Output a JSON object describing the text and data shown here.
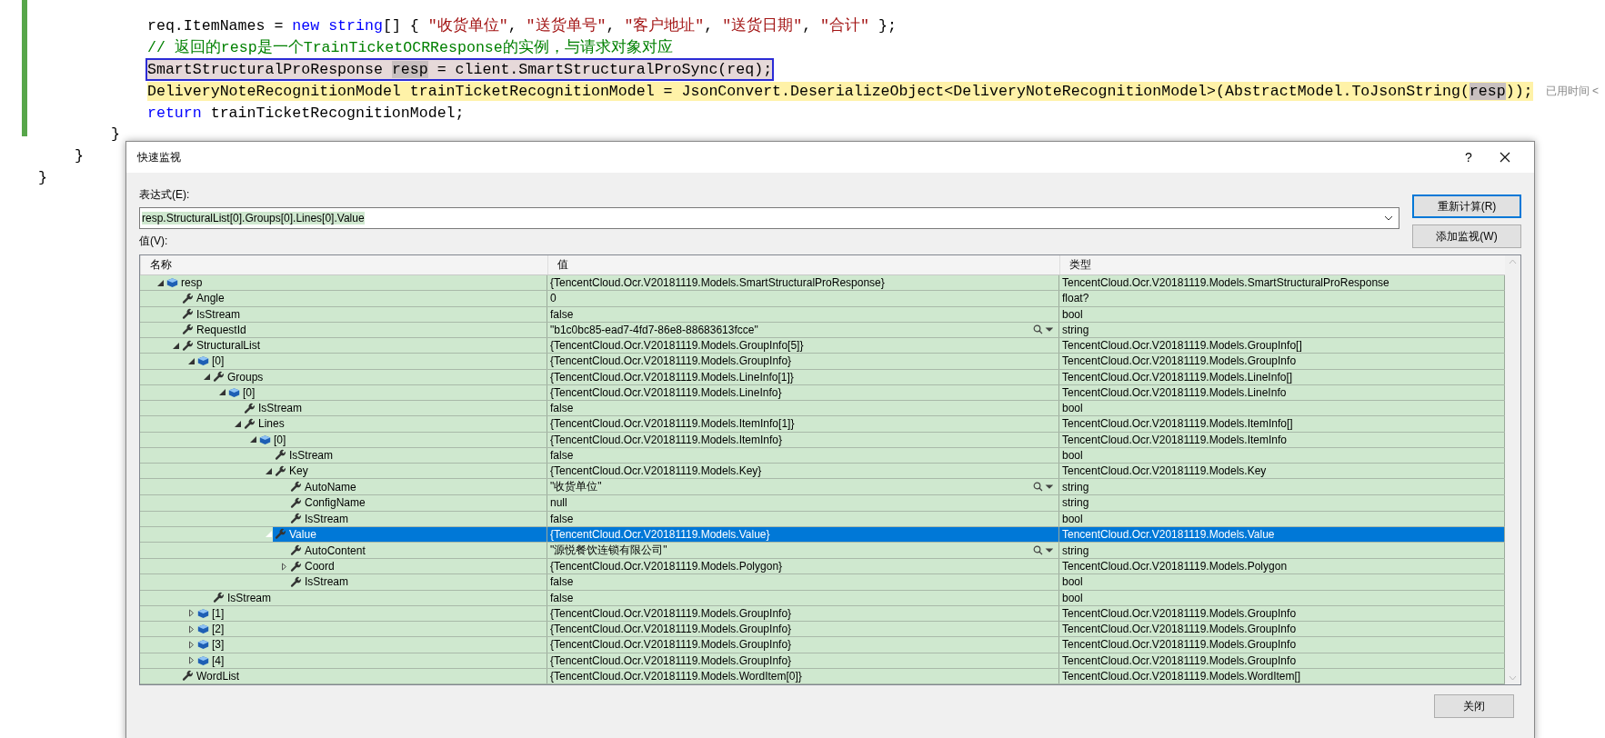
{
  "editor": {
    "lines": [
      {
        "selected": false,
        "current": false,
        "segments": [
          {
            "kind": "plain",
            "text": "req.ItemNames = "
          },
          {
            "kind": "keyword",
            "text": "new string"
          },
          {
            "kind": "plain",
            "text": "[] { "
          },
          {
            "kind": "string",
            "text": "\"收货单位\""
          },
          {
            "kind": "plain",
            "text": ", "
          },
          {
            "kind": "string",
            "text": "\"送货单号\""
          },
          {
            "kind": "plain",
            "text": ", "
          },
          {
            "kind": "string",
            "text": "\"客户地址\""
          },
          {
            "kind": "plain",
            "text": ", "
          },
          {
            "kind": "string",
            "text": "\"送货日期\""
          },
          {
            "kind": "plain",
            "text": ", "
          },
          {
            "kind": "string",
            "text": "\"合计\""
          },
          {
            "kind": "plain",
            "text": " };"
          }
        ]
      },
      {
        "selected": false,
        "current": false,
        "segments": [
          {
            "kind": "comment",
            "text": "// 返回的resp是一个TrainTicketOCRResponse的实例，与请求对象对应"
          }
        ]
      },
      {
        "selected": true,
        "current": false,
        "segments": [
          {
            "kind": "plain",
            "text": "SmartStructuralProResponse "
          },
          {
            "kind": "reference",
            "text": "resp"
          },
          {
            "kind": "plain",
            "text": " = client.SmartStructuralProSync(req);"
          }
        ]
      },
      {
        "selected": false,
        "current": true,
        "segments": [
          {
            "kind": "plain",
            "text": "DeliveryNoteRecognitionModel trainTicketRecognitionModel = JsonConvert.DeserializeObject<DeliveryNoteRecognitionModel>(AbstractModel.ToJsonString("
          },
          {
            "kind": "reference",
            "text": "resp"
          },
          {
            "kind": "plain",
            "text": "));"
          }
        ],
        "hint": "已用时间 <"
      },
      {
        "selected": false,
        "current": false,
        "segments": [
          {
            "kind": "keyword",
            "text": "return"
          },
          {
            "kind": "plain",
            "text": " trainTicketRecognitionModel;"
          }
        ]
      }
    ],
    "braces": [
      "}",
      "}",
      "}"
    ]
  },
  "quick_watch": {
    "title": "快速监视",
    "help": "?",
    "expression_label": "表达式(E):",
    "expression": "resp.StructuralList[0].Groups[0].Lines[0].Value",
    "value_label": "值(V):",
    "buttons": [
      {
        "label": "重新计算(R)",
        "kind": "default"
      },
      {
        "label": "添加监视(W)",
        "kind": "normal"
      }
    ],
    "columns": [
      "名称",
      "值",
      "类型"
    ],
    "items": [
      {
        "name": "resp",
        "kind": "object",
        "expanded": true,
        "value": "{TencentCloud.Ocr.V20181119.Models.SmartStructuralProResponse}",
        "type": "TencentCloud.Ocr.V20181119.Models.SmartStructuralProResponse",
        "viewer": false,
        "selected": false,
        "children": [
          {
            "name": "Angle",
            "kind": "property",
            "value": "0",
            "type": "float?",
            "viewer": false,
            "selected": false
          },
          {
            "name": "IsStream",
            "kind": "property",
            "value": "false",
            "type": "bool",
            "viewer": false,
            "selected": false
          },
          {
            "name": "RequestId",
            "kind": "property",
            "value": "\"b1c0bc85-ead7-4fd7-86e8-88683613fcce\"",
            "type": "string",
            "viewer": true,
            "selected": false
          },
          {
            "name": "StructuralList",
            "kind": "property",
            "expanded": true,
            "value": "{TencentCloud.Ocr.V20181119.Models.GroupInfo[5]}",
            "type": "TencentCloud.Ocr.V20181119.Models.GroupInfo[]",
            "viewer": false,
            "selected": false,
            "children": [
              {
                "name": "[0]",
                "kind": "object",
                "expanded": true,
                "value": "{TencentCloud.Ocr.V20181119.Models.GroupInfo}",
                "type": "TencentCloud.Ocr.V20181119.Models.GroupInfo",
                "viewer": false,
                "selected": false,
                "children": [
                  {
                    "name": "Groups",
                    "kind": "property",
                    "expanded": true,
                    "value": "{TencentCloud.Ocr.V20181119.Models.LineInfo[1]}",
                    "type": "TencentCloud.Ocr.V20181119.Models.LineInfo[]",
                    "viewer": false,
                    "selected": false,
                    "children": [
                      {
                        "name": "[0]",
                        "kind": "object",
                        "expanded": true,
                        "value": "{TencentCloud.Ocr.V20181119.Models.LineInfo}",
                        "type": "TencentCloud.Ocr.V20181119.Models.LineInfo",
                        "viewer": false,
                        "selected": false,
                        "children": [
                          {
                            "name": "IsStream",
                            "kind": "property",
                            "value": "false",
                            "type": "bool",
                            "viewer": false,
                            "selected": false
                          },
                          {
                            "name": "Lines",
                            "kind": "property",
                            "expanded": true,
                            "value": "{TencentCloud.Ocr.V20181119.Models.ItemInfo[1]}",
                            "type": "TencentCloud.Ocr.V20181119.Models.ItemInfo[]",
                            "viewer": false,
                            "selected": false,
                            "children": [
                              {
                                "name": "[0]",
                                "kind": "object",
                                "expanded": true,
                                "value": "{TencentCloud.Ocr.V20181119.Models.ItemInfo}",
                                "type": "TencentCloud.Ocr.V20181119.Models.ItemInfo",
                                "viewer": false,
                                "selected": false,
                                "children": [
                                  {
                                    "name": "IsStream",
                                    "kind": "property",
                                    "value": "false",
                                    "type": "bool",
                                    "viewer": false,
                                    "selected": false
                                  },
                                  {
                                    "name": "Key",
                                    "kind": "property",
                                    "expanded": true,
                                    "value": "{TencentCloud.Ocr.V20181119.Models.Key}",
                                    "type": "TencentCloud.Ocr.V20181119.Models.Key",
                                    "viewer": false,
                                    "selected": false,
                                    "children": [
                                      {
                                        "name": "AutoName",
                                        "kind": "property",
                                        "value": "\"收货单位\"",
                                        "type": "string",
                                        "viewer": true,
                                        "selected": false
                                      },
                                      {
                                        "name": "ConfigName",
                                        "kind": "property",
                                        "value": "null",
                                        "type": "string",
                                        "viewer": false,
                                        "selected": false
                                      },
                                      {
                                        "name": "IsStream",
                                        "kind": "property",
                                        "value": "false",
                                        "type": "bool",
                                        "viewer": false,
                                        "selected": false
                                      }
                                    ]
                                  },
                                  {
                                    "name": "Value",
                                    "kind": "property",
                                    "expanded": true,
                                    "value": "{TencentCloud.Ocr.V20181119.Models.Value}",
                                    "type": "TencentCloud.Ocr.V20181119.Models.Value",
                                    "viewer": false,
                                    "selected": true,
                                    "children": [
                                      {
                                        "name": "AutoContent",
                                        "kind": "property",
                                        "value": "\"源悦餐饮连锁有限公司\"",
                                        "type": "string",
                                        "viewer": true,
                                        "selected": false
                                      },
                                      {
                                        "name": "Coord",
                                        "kind": "property",
                                        "expanded": false,
                                        "value": "{TencentCloud.Ocr.V20181119.Models.Polygon}",
                                        "type": "TencentCloud.Ocr.V20181119.Models.Polygon",
                                        "viewer": false,
                                        "selected": false
                                      },
                                      {
                                        "name": "IsStream",
                                        "kind": "property",
                                        "value": "false",
                                        "type": "bool",
                                        "viewer": false,
                                        "selected": false
                                      }
                                    ]
                                  }
                                ]
                              }
                            ]
                          }
                        ]
                      }
                    ]
                  },
                  {
                    "name": "IsStream",
                    "kind": "property",
                    "value": "false",
                    "type": "bool",
                    "viewer": false,
                    "selected": false
                  }
                ]
              },
              {
                "name": "[1]",
                "kind": "object",
                "expanded": false,
                "value": "{TencentCloud.Ocr.V20181119.Models.GroupInfo}",
                "type": "TencentCloud.Ocr.V20181119.Models.GroupInfo",
                "viewer": false,
                "selected": false
              },
              {
                "name": "[2]",
                "kind": "object",
                "expanded": false,
                "value": "{TencentCloud.Ocr.V20181119.Models.GroupInfo}",
                "type": "TencentCloud.Ocr.V20181119.Models.GroupInfo",
                "viewer": false,
                "selected": false
              },
              {
                "name": "[3]",
                "kind": "object",
                "expanded": false,
                "value": "{TencentCloud.Ocr.V20181119.Models.GroupInfo}",
                "type": "TencentCloud.Ocr.V20181119.Models.GroupInfo",
                "viewer": false,
                "selected": false
              },
              {
                "name": "[4]",
                "kind": "object",
                "expanded": false,
                "value": "{TencentCloud.Ocr.V20181119.Models.GroupInfo}",
                "type": "TencentCloud.Ocr.V20181119.Models.GroupInfo",
                "viewer": false,
                "selected": false
              }
            ]
          },
          {
            "name": "WordList",
            "kind": "property",
            "value": "{TencentCloud.Ocr.V20181119.Models.WordItem[0]}",
            "type": "TencentCloud.Ocr.V20181119.Models.WordItem[]",
            "viewer": false,
            "selected": false
          }
        ]
      }
    ],
    "close_button": "关闭"
  }
}
